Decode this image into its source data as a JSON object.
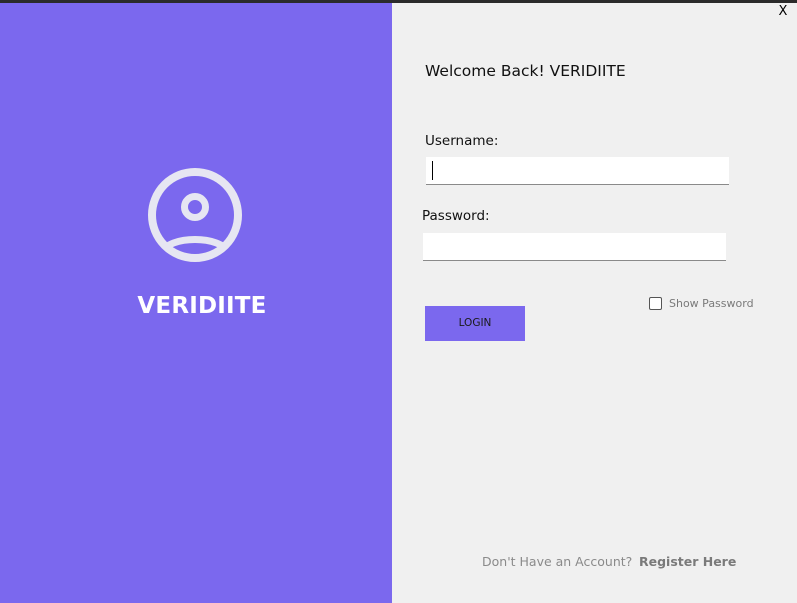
{
  "window": {
    "close_label": "X"
  },
  "brand": {
    "name": "VERIDIITE",
    "panel_color": "#7b68ee",
    "icon": "user-circle-icon"
  },
  "form": {
    "welcome": "Welcome Back! VERIDIITE",
    "username_label": "Username:",
    "username_value": "",
    "password_label": "Password:",
    "password_value": "",
    "login_label": "LOGIN",
    "show_password_label": "Show Password",
    "show_password_checked": false
  },
  "footer": {
    "account_text": "Don't Have an Account?",
    "register_label": "Register Here"
  }
}
